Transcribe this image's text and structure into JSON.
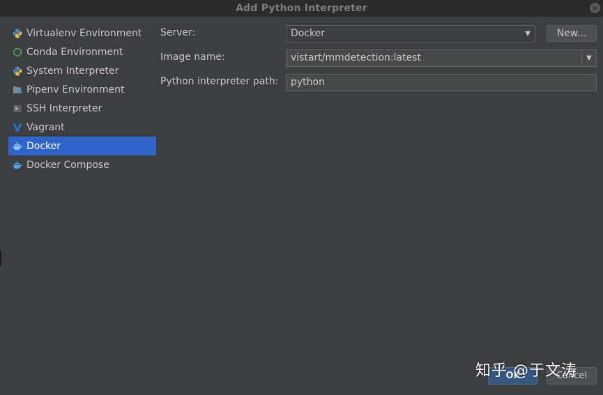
{
  "window": {
    "title": "Add Python Interpreter",
    "close_glyph": "×"
  },
  "sidebar": {
    "items": [
      {
        "label": "Virtualenv Environment",
        "icon": "python-icon",
        "selected": false
      },
      {
        "label": "Conda Environment",
        "icon": "conda-icon",
        "selected": false
      },
      {
        "label": "System Interpreter",
        "icon": "python-icon",
        "selected": false
      },
      {
        "label": "Pipenv Environment",
        "icon": "pipenv-icon",
        "selected": false
      },
      {
        "label": "SSH Interpreter",
        "icon": "terminal-icon",
        "selected": false
      },
      {
        "label": "Vagrant",
        "icon": "vagrant-icon",
        "selected": false
      },
      {
        "label": "Docker",
        "icon": "docker-icon",
        "selected": true
      },
      {
        "label": "Docker Compose",
        "icon": "docker-icon",
        "selected": false
      }
    ]
  },
  "form": {
    "server_label": "Server:",
    "server_value": "Docker",
    "new_button": "New...",
    "image_label": "Image name:",
    "image_value": "vistart/mmdetection:latest",
    "path_label": "Python interpreter path:",
    "path_value": "python"
  },
  "footer": {
    "ok_label": "OK",
    "cancel_label": "Cancel"
  },
  "watermark": "知乎 @于文涛",
  "colors": {
    "background": "#3c3f41",
    "titlebar": "#2b2b2b",
    "selection": "#2f65ca",
    "text": "#bbbbbb"
  }
}
